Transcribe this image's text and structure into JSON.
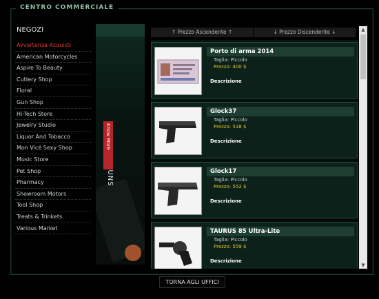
{
  "window": {
    "title": "CENTRO COMMERCIALE"
  },
  "sidebar": {
    "title": "NEGOZI",
    "items": [
      {
        "label": "Avvertenza Acquisti",
        "active": true
      },
      {
        "label": "American Motorcycles"
      },
      {
        "label": "Aspire To Beauty"
      },
      {
        "label": "Cutlery Shop"
      },
      {
        "label": "Floral"
      },
      {
        "label": "Gun Shop"
      },
      {
        "label": "Hi-Tech Store"
      },
      {
        "label": "Jewelry Studio"
      },
      {
        "label": "Liquor And Tobacco"
      },
      {
        "label": "Mon Vicé Sexy Shop"
      },
      {
        "label": "Music Store"
      },
      {
        "label": "Pet Shop"
      },
      {
        "label": "Pharmacy"
      },
      {
        "label": "Showroom Motors"
      },
      {
        "label": "Tool Shop"
      },
      {
        "label": "Treats & Trinkets"
      },
      {
        "label": "Various Market"
      }
    ]
  },
  "banner": {
    "text": "HAND GUNS",
    "button": "Know More"
  },
  "sort": {
    "asc": "↑ Prezzo Ascendente ↑",
    "desc": "↓ Prezzo Discendente ↓"
  },
  "products": [
    {
      "name": "Porto di arma 2014",
      "size_label": "Taglia:",
      "size": "Piccolo",
      "price_label": "Prezzo:",
      "price": "400 $",
      "desc": "Descrizione",
      "icon": "permit-card"
    },
    {
      "name": "Glock37",
      "size_label": "Taglia:",
      "size": "Piccolo",
      "price_label": "Prezzo:",
      "price": "518 $",
      "desc": "Descrizione",
      "icon": "pistol"
    },
    {
      "name": "Glock17",
      "size_label": "Taglia:",
      "size": "Piccolo",
      "price_label": "Prezzo:",
      "price": "552 $",
      "desc": "Descrizione",
      "icon": "pistol"
    },
    {
      "name": "TAURUS 85 Ultra-Lite",
      "size_label": "Taglia:",
      "size": "Piccolo",
      "price_label": "Prezzo:",
      "price": "559 $",
      "desc": "Descrizione",
      "icon": "revolver"
    }
  ],
  "footer": {
    "button": "TORNA AGLI UFFICI"
  },
  "colors": {
    "accent_red": "#e0332b",
    "price_gold": "#e6c234",
    "card_bg": "#0c211a"
  }
}
